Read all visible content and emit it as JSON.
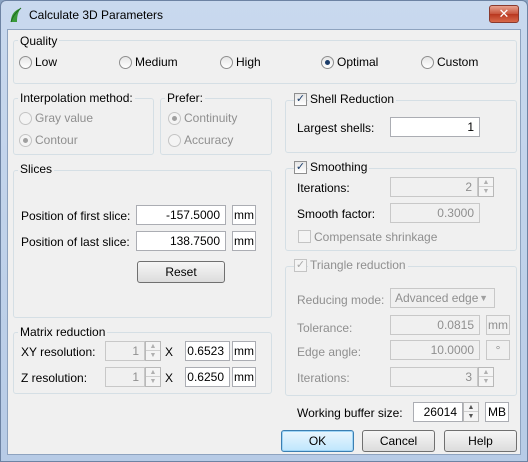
{
  "window": {
    "title": "Calculate 3D Parameters",
    "close_glyph": "✕"
  },
  "quality": {
    "label": "Quality",
    "options": [
      "Low",
      "Medium",
      "High",
      "Optimal",
      "Custom"
    ],
    "selected": "Optimal"
  },
  "interpolation": {
    "label": "Interpolation method:",
    "options": [
      "Gray value",
      "Contour"
    ],
    "selected": "Contour"
  },
  "prefer": {
    "label": "Prefer:",
    "options": [
      "Continuity",
      "Accuracy"
    ],
    "selected": "Continuity"
  },
  "slices": {
    "label": "Slices",
    "first_label": "Position of first slice:",
    "first_value": "-157.5000",
    "last_label": "Position of last slice:",
    "last_value": "138.7500",
    "unit": "mm",
    "reset_label": "Reset"
  },
  "matrix": {
    "label": "Matrix reduction",
    "xy_label": "XY resolution:",
    "xy_factor": "1",
    "xy_value": "0.6523",
    "z_label": "Z resolution:",
    "z_factor": "1",
    "z_value": "0.6250",
    "x_sep": "X",
    "unit": "mm"
  },
  "shell": {
    "label": "Shell Reduction",
    "checked": true,
    "largest_label": "Largest shells:",
    "largest_value": "1"
  },
  "smoothing": {
    "label": "Smoothing",
    "checked": true,
    "iterations_label": "Iterations:",
    "iterations_value": "2",
    "factor_label": "Smooth factor:",
    "factor_value": "0.3000",
    "compensate_label": "Compensate shrinkage",
    "compensate_checked": false
  },
  "triangle": {
    "label": "Triangle reduction",
    "checked": true,
    "mode_label": "Reducing mode:",
    "mode_value": "Advanced edge",
    "tolerance_label": "Tolerance:",
    "tolerance_value": "0.0815",
    "tolerance_unit": "mm",
    "angle_label": "Edge angle:",
    "angle_value": "10.0000",
    "angle_unit": "°",
    "iterations_label": "Iterations:",
    "iterations_value": "3"
  },
  "buffer": {
    "label": "Working buffer size:",
    "value": "26014",
    "unit": "MB"
  },
  "buttons": {
    "ok": "OK",
    "cancel": "Cancel",
    "help": "Help"
  },
  "check_glyph": "✓",
  "colors": {
    "accent": "#1a3c6a",
    "titlebar": "#c9d9ee",
    "close": "#c7533b"
  }
}
